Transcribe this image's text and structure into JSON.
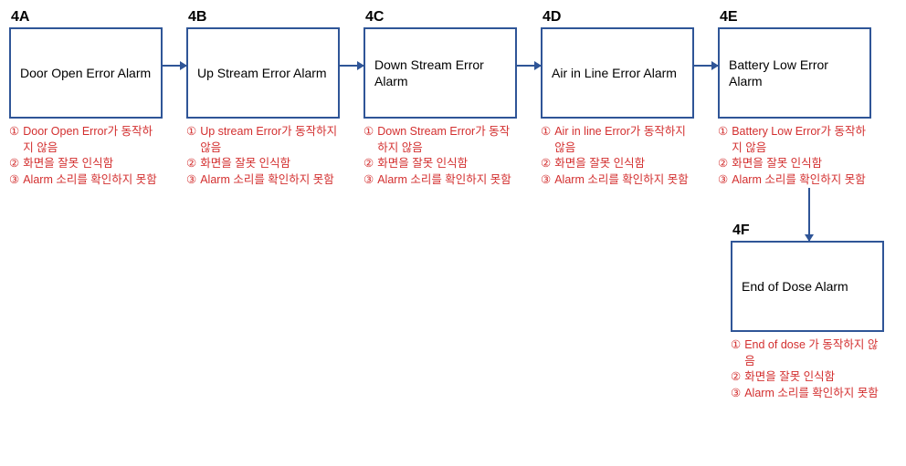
{
  "nodes": {
    "a": {
      "label": "4A",
      "title": "Door Open Error Alarm",
      "notes": [
        "Door Open Error가 동작하지 않음",
        "화면을 잘못 인식함",
        "Alarm 소리를 확인하지 못함"
      ]
    },
    "b": {
      "label": "4B",
      "title": "Up Stream Error Alarm",
      "notes": [
        "Up stream Error가 동작하지 않음",
        "화면을 잘못 인식함",
        "Alarm 소리를 확인하지 못함"
      ]
    },
    "c": {
      "label": "4C",
      "title": "Down Stream Error Alarm",
      "notes": [
        "Down Stream Error가 동작하지 않음",
        "화면을 잘못 인식함",
        "Alarm 소리를 확인하지 못함"
      ]
    },
    "d": {
      "label": "4D",
      "title": "Air in Line Error Alarm",
      "notes": [
        "Air in line Error가 동작하지 않음",
        "화면을 잘못 인식함",
        "Alarm 소리를 확인하지 못함"
      ]
    },
    "e": {
      "label": "4E",
      "title": "Battery Low Error Alarm",
      "notes": [
        "Battery Low Error가 동작하지 않음",
        "화면을 잘못 인식함",
        "Alarm 소리를 확인하지 못함"
      ]
    },
    "f": {
      "label": "4F",
      "title": "End of Dose Alarm",
      "notes": [
        "End of dose 가 동작하지 않음",
        "화면을 잘못 인식함",
        "Alarm 소리를 확인하지 못함"
      ]
    }
  },
  "markers": [
    "①",
    "②",
    "③"
  ]
}
